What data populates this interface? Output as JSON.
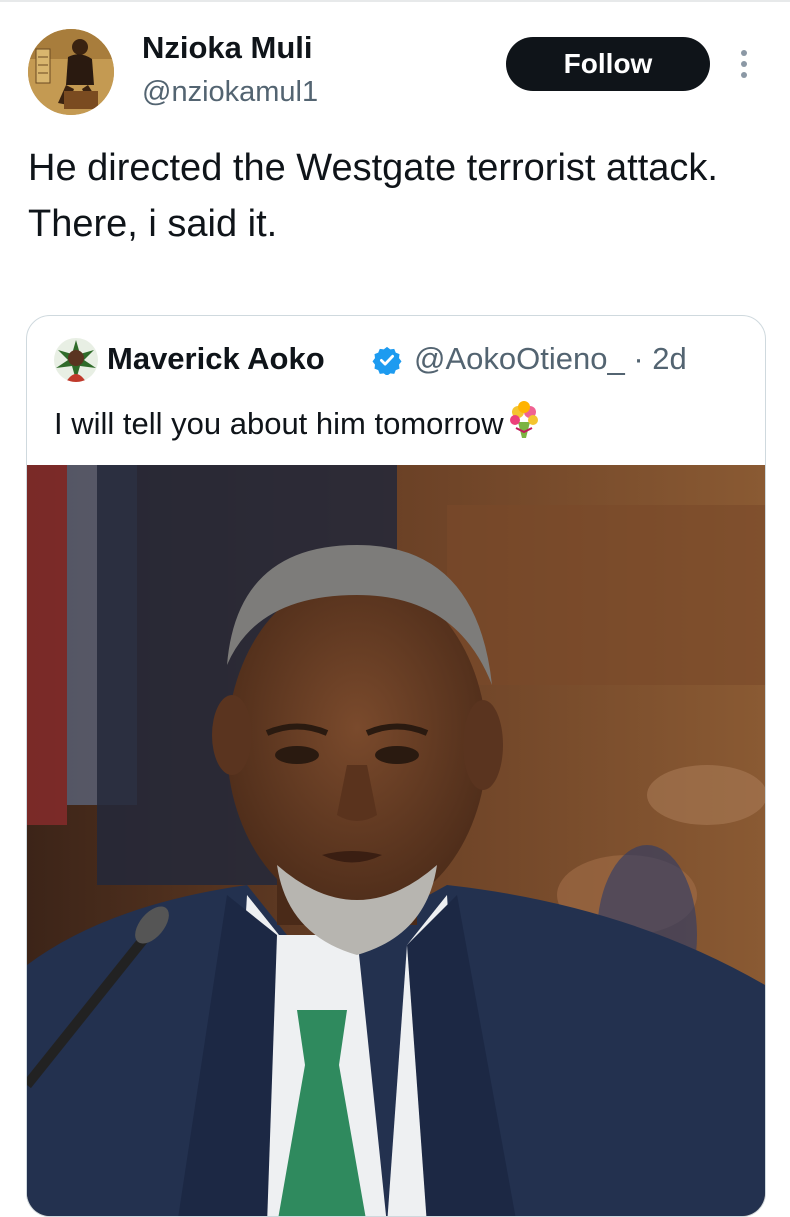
{
  "author": {
    "name": "Nzioka Muli",
    "handle": "@nziokamul1"
  },
  "follow_label": "Follow",
  "tweet": {
    "lines": [
      "He directed the Westgate terrorist attack.",
      "There, i said it."
    ]
  },
  "quoted": {
    "name": "Maverick Aoko",
    "handle_time": "@AokoOtieno_ · 2d",
    "text": "I will tell you about him tomorrow",
    "emoji_icon": "bouquet-icon"
  },
  "colors": {
    "button_bg": "#0f1419",
    "secondary_text": "#536471",
    "verified": "#1d9bf0",
    "card_border": "#cfd9de"
  }
}
